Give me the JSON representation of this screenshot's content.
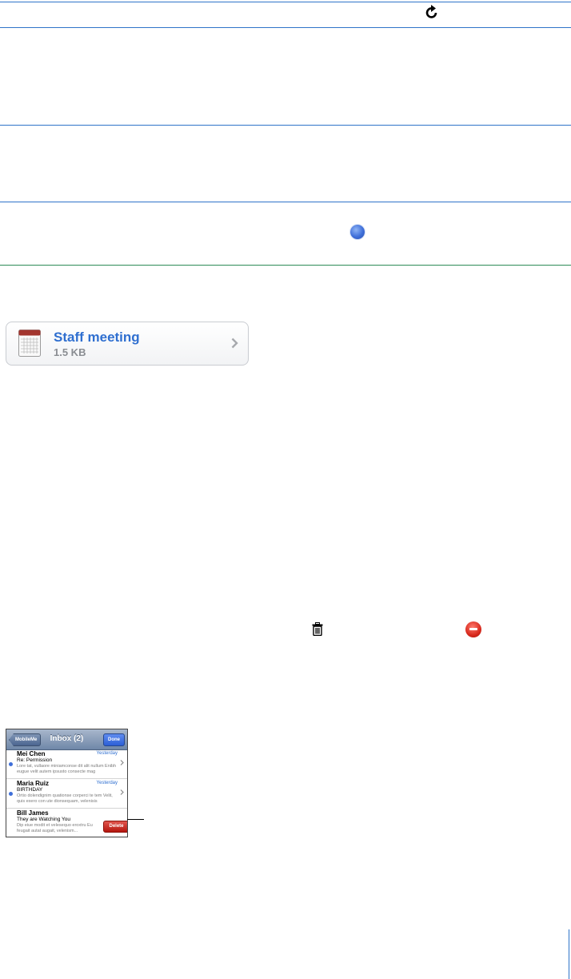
{
  "attachment": {
    "title": "Staff meeting",
    "size": "1.5 KB"
  },
  "inbox": {
    "back_label": "MobileMe",
    "title": "Inbox (2)",
    "done_label": "Done",
    "messages": [
      {
        "from": "Mei Chen",
        "subject": "Re: Permission",
        "snippet": "Lore tat, vullaore miniamconse dit alit nullum Enibh eugue velit autem ipsusto consecte mag",
        "date": "Yesterday",
        "unread": true
      },
      {
        "from": "Maria Ruiz",
        "subject": "BIRTHDAY",
        "snippet": "Ortio dolendignim quationse corperci te tem Velit, quis exero con ute dionsequam, velenisis",
        "date": "Yesterday",
        "unread": true
      },
      {
        "from": "Bill James",
        "subject": "They are Watching You",
        "snippet": "Dip eiue modit et velesequo eroxtru Eu feugait autat augait, velenism...",
        "date": "",
        "unread": false,
        "delete_label": "Delete"
      }
    ]
  },
  "colors": {
    "rule": "#2f73c9",
    "link_blue": "#2f6fd0",
    "delete_red": "#c21d14"
  }
}
